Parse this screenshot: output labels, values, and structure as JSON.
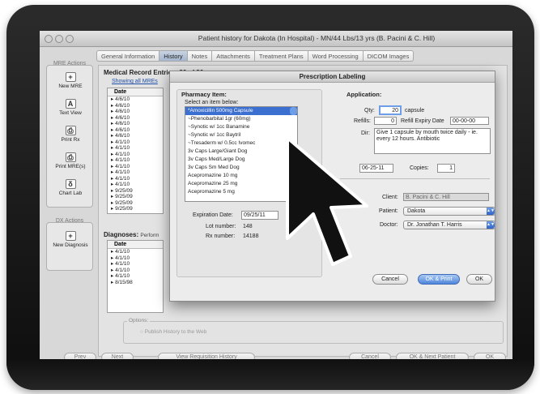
{
  "window": {
    "title": "Patient history for Dakota (In Hospital) - MN/44 Lbs/13 yrs (B. Pacini & C. Hill)"
  },
  "tabs": [
    "General Information",
    "History",
    "Notes",
    "Attachments",
    "Treatment Plans",
    "Word Processing",
    "DICOM Images"
  ],
  "active_tab_index": 1,
  "mre_actions": {
    "label": "MRE Actions",
    "buttons": [
      {
        "label": "New MRE",
        "icon": "plus-icon",
        "glyph": "+"
      },
      {
        "label": "Text View",
        "icon": "text-icon",
        "glyph": "A"
      },
      {
        "label": "Print Rx",
        "icon": "printer-icon",
        "glyph": "⎙"
      },
      {
        "label": "Print MRE(s)",
        "icon": "printer-icon",
        "glyph": "⎙"
      },
      {
        "label": "Chart Lab",
        "icon": "lab-icon",
        "glyph": "δ"
      }
    ]
  },
  "dx_actions": {
    "label": "DX Actions",
    "buttons": [
      {
        "label": "New Diagnosis",
        "icon": "plus-icon",
        "glyph": "+"
      }
    ]
  },
  "records": {
    "title": "Medical Record Entries: 86 of 86",
    "show_link": "Showing all MREs",
    "column_date": "Date",
    "dates": [
      "4/6/10",
      "4/6/10",
      "4/6/10",
      "4/6/10",
      "4/6/10",
      "4/6/10",
      "4/6/10",
      "4/1/10",
      "4/1/10",
      "4/1/10",
      "4/1/10",
      "4/1/10",
      "4/1/10",
      "4/1/10",
      "4/1/10",
      "9/25/09",
      "9/25/09",
      "9/25/09",
      "9/25/09"
    ]
  },
  "diagnoses": {
    "title": "Diagnoses:",
    "subtitle": "Perform",
    "column_date": "Date",
    "dates": [
      "4/1/10",
      "4/1/10",
      "4/1/10",
      "4/1/10",
      "4/1/10",
      "8/15/98"
    ]
  },
  "options": {
    "label": "Options:",
    "publish": "Publish History to the Web"
  },
  "bottom_buttons": {
    "prev": "Prev",
    "next": "Next",
    "view_requisition": "View Requisition History",
    "cancel": "Cancel",
    "ok_next": "OK & Next Patient",
    "ok": "OK"
  },
  "dialog": {
    "title": "Prescription Labeling",
    "pharmacy": {
      "label": "Pharmacy Item:",
      "select_label": "Select an item below:",
      "items": [
        "*Amoxicillin 500mg Capsule",
        "~Phenobarbital 1gr (60mg)",
        "~Synotic w/ 1cc Banamine",
        "~Synotic w/ 1cc Baytril",
        "~Tresaderm w/ 0.5cc Ivomec",
        "3v Caps Large/Giant Dog",
        "3v Caps Med/Large Dog",
        "3v Caps Sm Med Dog",
        "Acepromazine 10 mg",
        "Acepromazine 25 mg",
        "Acepromazine 5 mg"
      ],
      "selected_index": 0,
      "expiration_label": "Expiration Date:",
      "expiration_value": "09/25/11",
      "lot_label": "Lot number:",
      "lot_value": "148",
      "rx_label": "Rx number:",
      "rx_value": "14188"
    },
    "application": {
      "label": "Application:",
      "qty_label": "Qty:",
      "qty_value": "20",
      "qty_unit": "capsule",
      "refills_label": "Refills:",
      "refills_value": "0",
      "refill_expiry_label": "Refill Expiry Date",
      "refill_expiry_value": "00-00-00",
      "dir_label": "Dir:",
      "dir_value_line1": "Give 1 capsule by mouth twice daily - ie.",
      "dir_value_line2": "every 12 hours. Antibiotic",
      "date_value": "06-25-11",
      "copies_label": "Copies:",
      "copies_value": "1"
    },
    "client_label": "Client:",
    "client_value": "B. Pacini & C. Hill",
    "patient_label": "Patient:",
    "patient_value": "Dakota",
    "doctor_label": "Doctor:",
    "doctor_value": "Dr. Jonathan T. Harris",
    "buttons": {
      "cancel": "Cancel",
      "ok_print": "OK & Print",
      "ok": "OK"
    }
  },
  "colors": {
    "accent": "#4f86da",
    "selection": "#3b6fd0",
    "bezel": "#141414"
  }
}
